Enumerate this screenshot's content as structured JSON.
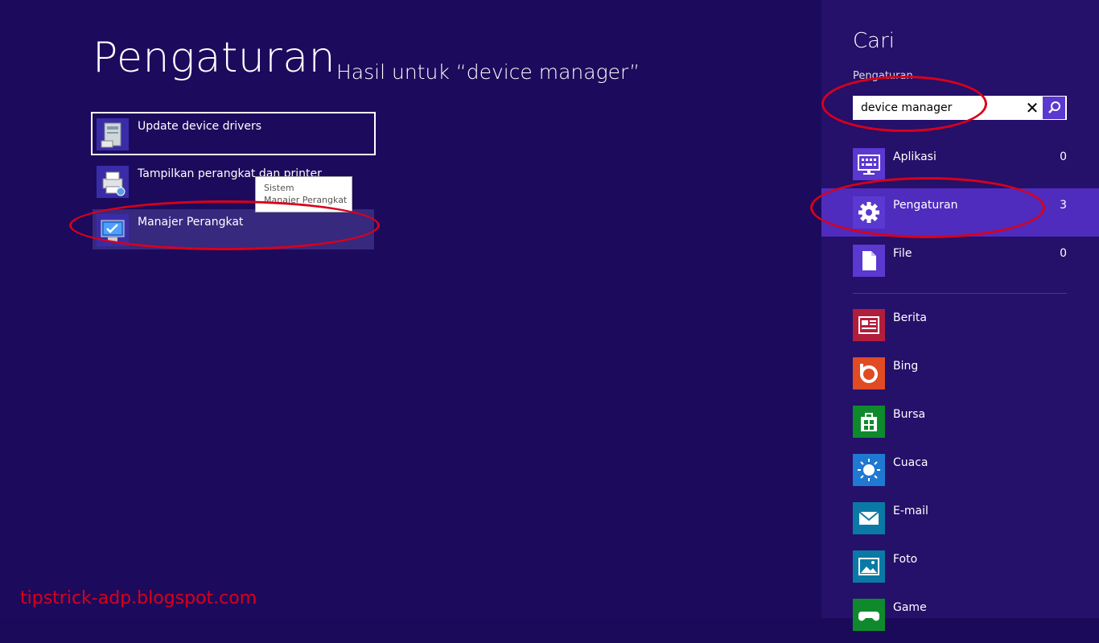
{
  "main": {
    "title": "Pengaturan",
    "subtitle": "Hasil untuk “device manager”",
    "results": [
      {
        "label": "Update device drivers",
        "icon": "device-drivers-icon"
      },
      {
        "label": "Tampilkan perangkat dan printer",
        "icon": "printer-icon"
      },
      {
        "label": "Manajer Perangkat",
        "icon": "device-manager-icon"
      }
    ],
    "tooltip": {
      "line1": "Sistem",
      "line2": "Manajer Perangkat"
    }
  },
  "watermark": "tipstrick-adp.blogspot.com",
  "pane": {
    "title": "Cari",
    "scope": "Pengaturan",
    "search": {
      "value": "device manager"
    },
    "categories": [
      {
        "label": "Aplikasi",
        "count": "0",
        "icon": "keyboard-icon"
      },
      {
        "label": "Pengaturan",
        "count": "3",
        "icon": "gear-icon"
      },
      {
        "label": "File",
        "count": "0",
        "icon": "file-icon"
      }
    ],
    "apps": [
      {
        "label": "Berita",
        "icon": "news-icon",
        "color": "#b01e3c"
      },
      {
        "label": "Bing",
        "icon": "bing-icon",
        "color": "#e04b24"
      },
      {
        "label": "Bursa",
        "icon": "store-icon",
        "color": "#0e8a2c"
      },
      {
        "label": "Cuaca",
        "icon": "weather-icon",
        "color": "#1f78d1"
      },
      {
        "label": "E-mail",
        "icon": "mail-icon",
        "color": "#0b79a6"
      },
      {
        "label": "Foto",
        "icon": "photo-icon",
        "color": "#0b79a6"
      },
      {
        "label": "Game",
        "icon": "game-icon",
        "color": "#0e8a2c"
      }
    ]
  },
  "colors": {
    "background": "#1c0b5c",
    "pane": "#25106a",
    "accent": "#5b38d0",
    "annotation": "#d9001b"
  }
}
